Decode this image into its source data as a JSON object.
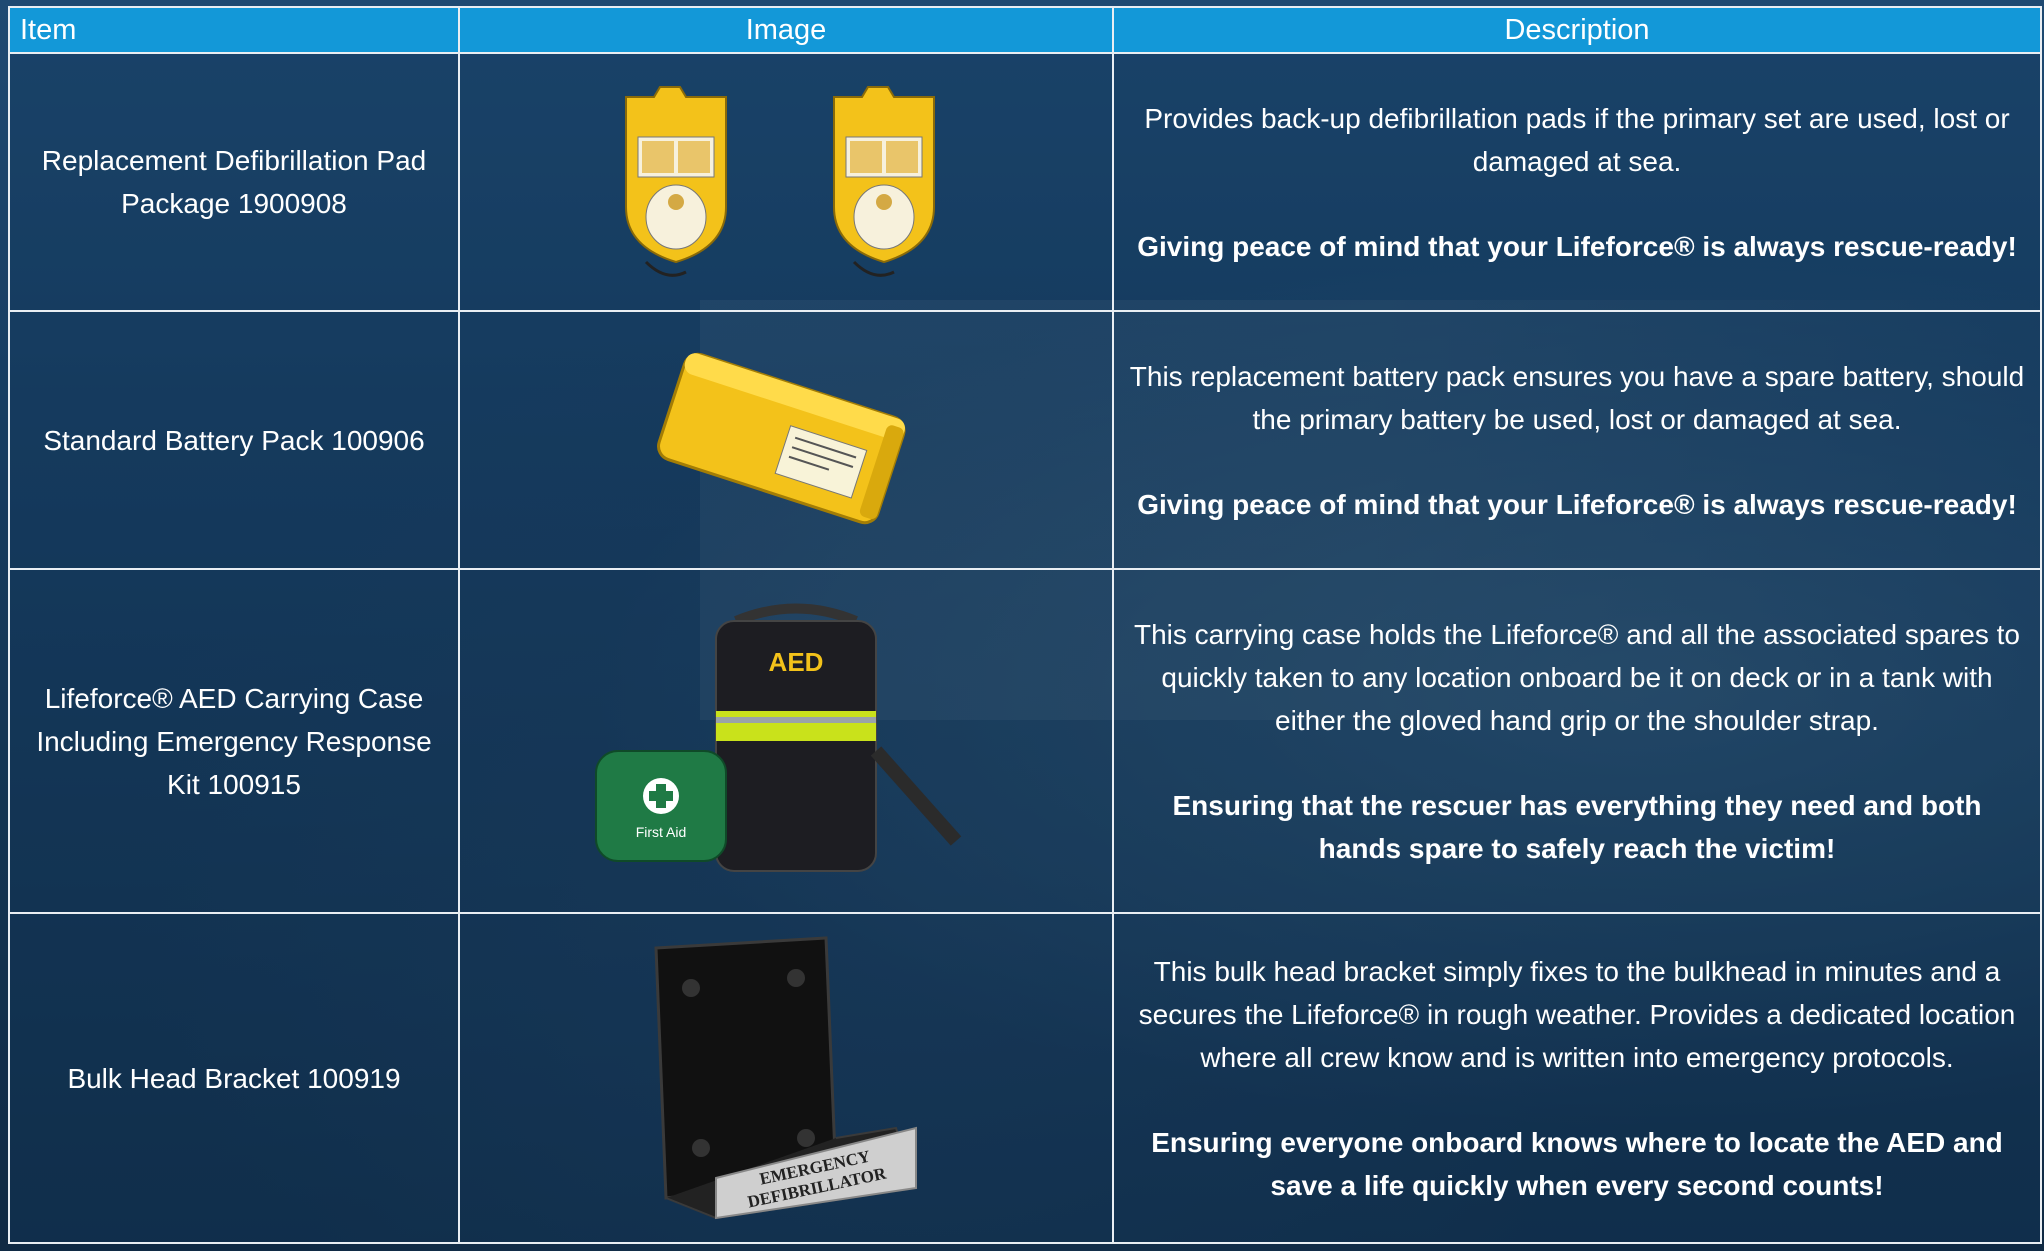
{
  "table": {
    "headers": {
      "item": "Item",
      "image": "Image",
      "description": "Description"
    },
    "rows": [
      {
        "item_line1": "Replacement Defibrillation Pad",
        "item_line2": "Package 1900908",
        "item_line3": "",
        "description": "Provides back-up defibrillation pads if the primary set are used, lost or damaged at sea.",
        "highlight": "Giving peace of mind that your Lifeforce® is always rescue-ready!",
        "image_icon": "defibrillation-pad-package-icon"
      },
      {
        "item_line1": "Standard Battery Pack 100906",
        "item_line2": "",
        "item_line3": "",
        "description": "This replacement battery pack ensures you have a spare battery, should the primary battery be used, lost or damaged at sea.",
        "highlight": "Giving peace of mind that your Lifeforce® is always rescue-ready!",
        "image_icon": "battery-pack-icon"
      },
      {
        "item_line1": "Lifeforce® AED Carrying Case",
        "item_line2": "Including Emergency Response",
        "item_line3": "Kit 100915",
        "description": "This carrying case holds the Lifeforce® and all the associated spares to quickly taken to any location onboard be it on deck or in a tank with either the gloved hand grip or the shoulder strap.",
        "highlight": "Ensuring that the rescuer has everything they need and both hands spare to safely reach the victim!",
        "image_icon": "aed-carrying-case-icon",
        "image_labels": {
          "case": "AED",
          "kit": "First Aid"
        }
      },
      {
        "item_line1": "Bulk Head Bracket 100919",
        "item_line2": "",
        "item_line3": "",
        "description": "This bulk head bracket simply fixes to the bulkhead in minutes and a secures the Lifeforce® in rough weather. Provides a dedicated location where all crew know and is written into emergency protocols.",
        "highlight": "Ensuring everyone onboard knows where to locate the AED and save a life quickly when every second counts!",
        "image_icon": "bulkhead-bracket-icon",
        "image_labels": {
          "plate_line1": "EMERGENCY",
          "plate_line2": "DEFIBRILLATOR"
        }
      }
    ]
  },
  "colors": {
    "header": "#1398d8",
    "grid": "#e9eef3",
    "background": "#173a5c",
    "product_yellow": "#f3c21a"
  }
}
